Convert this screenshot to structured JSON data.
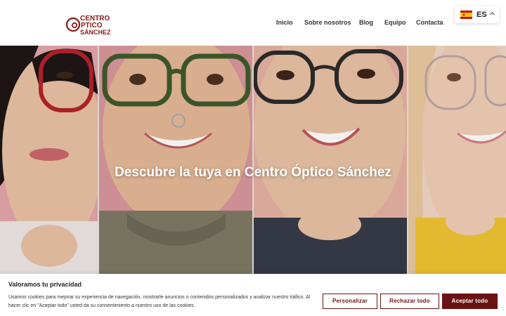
{
  "brand": {
    "logo_line1": "CENTRO",
    "logo_line2": "PTICO",
    "logo_line3": "SÁNCHEZ",
    "logo_color": "#8b1a1a"
  },
  "nav": {
    "items": [
      {
        "label": "Inicio"
      },
      {
        "label": "Sobre nosotros"
      },
      {
        "label": "Blog"
      },
      {
        "label": "Equipo"
      },
      {
        "label": "Contacta"
      }
    ]
  },
  "language": {
    "code": "ES",
    "flag_icon": "spain-flag-icon",
    "chevron_icon": "chevron-up-icon"
  },
  "hero": {
    "title": "Descubre la tuya en Centro Óptico Sánchez",
    "panels": [
      {
        "name": "hero-photo-red-glasses",
        "bg": "#e6a9ae",
        "glasses": "#b4212b"
      },
      {
        "name": "hero-photo-green-glasses",
        "bg": "#d99aa0",
        "glasses": "#3e5a2a"
      },
      {
        "name": "hero-photo-dark-glasses",
        "bg": "#e8b7a8",
        "glasses": "#2a2a2a"
      },
      {
        "name": "hero-photo-clear-glasses",
        "bg": "#f2d8c8",
        "glasses": "#b9a7a6"
      }
    ]
  },
  "cookie_banner": {
    "title": "Valoramos tu privacidad",
    "text": "Usamos cookies para mejorar su experiencia de navegación, mostrarle anuncios o contenidos personalizados y analizar nuestro tráfico. Al hacer clic en \"Aceptar todo\" usted da su consentimiento a nuestro uso de las cookies.",
    "btn_customize": "Personalizar",
    "btn_reject": "Rechazar todo",
    "btn_accept": "Aceptar todo",
    "accent": "#6b1212"
  }
}
